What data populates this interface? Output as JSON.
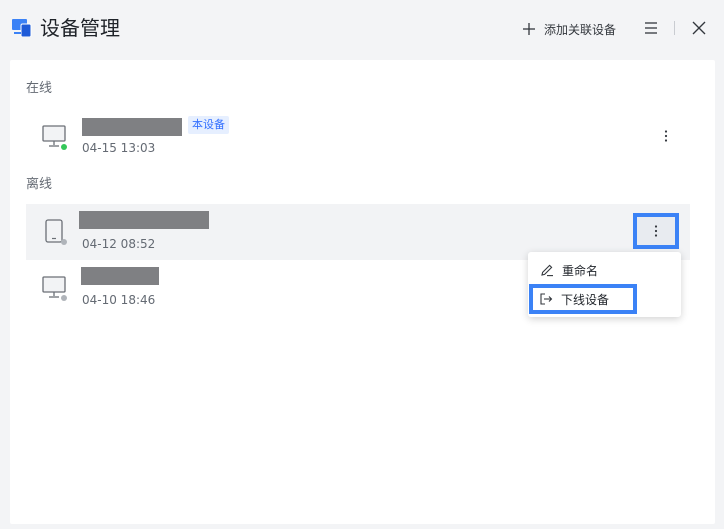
{
  "window": {
    "title": "设备管理",
    "add_label": "添加关联设备"
  },
  "sections": {
    "online_label": "在线",
    "offline_label": "离线"
  },
  "devices": {
    "online": [
      {
        "time": "04-15 13:03",
        "badge": "本设备",
        "type": "desktop-icon",
        "status_color": "#34c759"
      }
    ],
    "offline": [
      {
        "time": "04-12 08:52",
        "type": "tablet-icon",
        "status_color": "#b0b4ba"
      },
      {
        "time": "04-10 18:46",
        "type": "desktop-icon",
        "status_color": "#b0b4ba"
      }
    ]
  },
  "context_menu": {
    "rename_label": "重命名",
    "logout_label": "下线设备"
  },
  "colors": {
    "accent": "#3b82f6",
    "badge_bg": "#e6efff",
    "badge_text": "#3370ff"
  }
}
